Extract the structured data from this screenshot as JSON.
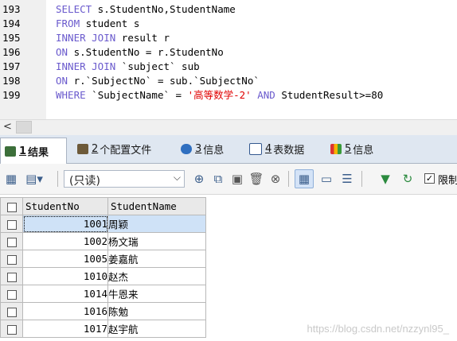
{
  "editor": {
    "lines": [
      {
        "no": "193",
        "parts": [
          {
            "t": "SELECT",
            "k": "kw"
          },
          {
            "t": " s.StudentNo,StudentName",
            "k": "op"
          }
        ]
      },
      {
        "no": "194",
        "parts": [
          {
            "t": "FROM",
            "k": "kw"
          },
          {
            "t": " student s",
            "k": "op"
          }
        ]
      },
      {
        "no": "195",
        "parts": [
          {
            "t": "INNER JOIN",
            "k": "kw"
          },
          {
            "t": " result r",
            "k": "op"
          }
        ]
      },
      {
        "no": "196",
        "parts": [
          {
            "t": "ON",
            "k": "kw"
          },
          {
            "t": " s.StudentNo = r.StudentNo",
            "k": "op"
          }
        ]
      },
      {
        "no": "197",
        "parts": [
          {
            "t": "INNER JOIN",
            "k": "kw"
          },
          {
            "t": " `subject` sub",
            "k": "op"
          }
        ]
      },
      {
        "no": "198",
        "parts": [
          {
            "t": "ON",
            "k": "kw"
          },
          {
            "t": " r.`SubjectNo` = sub.`SubjectNo`",
            "k": "op"
          }
        ]
      },
      {
        "no": "199",
        "parts": [
          {
            "t": "WHERE",
            "k": "kw"
          },
          {
            "t": " `SubjectName` = ",
            "k": "op"
          },
          {
            "t": "'高等数学-2'",
            "k": "str"
          },
          {
            "t": " ",
            "k": "op"
          },
          {
            "t": "AND",
            "k": "kw"
          },
          {
            "t": " StudentResult>=80",
            "k": "op"
          }
        ]
      }
    ],
    "scroll_left_arrow": "<"
  },
  "tabs": [
    {
      "num": "1",
      "label": "结果",
      "icon": "result-grid-icon",
      "active": true
    },
    {
      "num": "2",
      "label": "个配置文件",
      "icon": "profile-icon",
      "active": false
    },
    {
      "num": "3",
      "label": "信息",
      "icon": "info-icon",
      "active": false
    },
    {
      "num": "4",
      "label": "表数据",
      "icon": "table-data-icon",
      "active": false
    },
    {
      "num": "5",
      "label": "信息",
      "icon": "info-chart-icon",
      "active": false
    }
  ],
  "toolbar": {
    "mode_select": "(只读)",
    "limit_label": "限制"
  },
  "grid": {
    "columns": [
      "StudentNo",
      "StudentName"
    ],
    "rows": [
      {
        "no": "1001",
        "name": "周颖",
        "selected": true
      },
      {
        "no": "1002",
        "name": "杨文瑞",
        "selected": false
      },
      {
        "no": "1005",
        "name": "姜嘉航",
        "selected": false
      },
      {
        "no": "1010",
        "name": "赵杰",
        "selected": false
      },
      {
        "no": "1014",
        "name": "牛恩来",
        "selected": false
      },
      {
        "no": "1016",
        "name": "陈勉",
        "selected": false
      },
      {
        "no": "1017",
        "name": "赵宇航",
        "selected": false
      }
    ]
  },
  "watermark": "https://blog.csdn.net/nzzynl95_",
  "colors": {
    "keyword": "#6a5acd",
    "string": "#e00000",
    "selection": "#cfe2f7"
  }
}
